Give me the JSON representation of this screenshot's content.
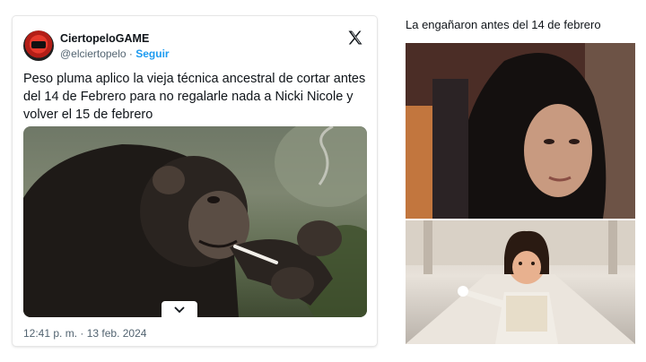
{
  "tweet": {
    "display_name": "CiertopeloGAME",
    "handle": "@elciertopelo",
    "separator": "·",
    "follow_label": "Seguir",
    "text": "Peso pluma aplico la vieja técnica ancestral de cortar antes del 14 de Febrero para no regalarle nada a Nicki Nicole y volver el 15 de febrero",
    "timestamp": "12:41 p. m. · 13 feb. 2024",
    "icons": {
      "avatar": "avatar",
      "platform": "x-logo-icon",
      "expand": "chevron-down-icon"
    }
  },
  "meme": {
    "caption": "La engañaron antes del 14 de febrero"
  }
}
